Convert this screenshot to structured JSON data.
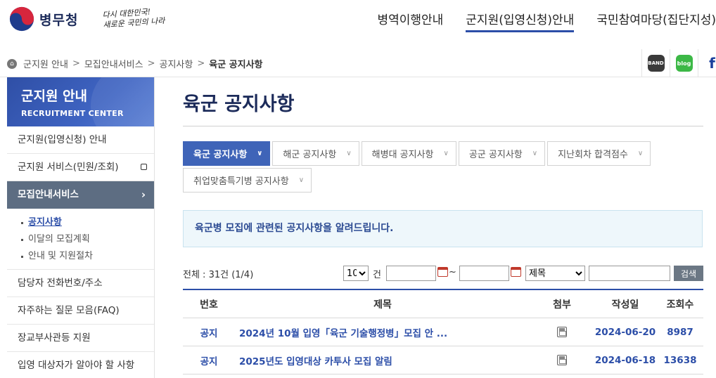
{
  "header": {
    "logo_text": "병무청",
    "slogan_line1": "다시 대한민국!",
    "slogan_line2": "새로운 국민의 나라",
    "gnb": [
      {
        "label": "병역이행안내",
        "active": false
      },
      {
        "label": "군지원(입영신청)안내",
        "active": true
      },
      {
        "label": "국민참여마당(집단지성)",
        "active": false
      }
    ]
  },
  "breadcrumb": [
    "군지원 안내",
    "모집안내서비스",
    "공지사항",
    "육군 공지사항"
  ],
  "social": [
    "BAND",
    "blog",
    "f"
  ],
  "sidebar": {
    "title": "군지원 안내",
    "subtitle": "RECRUITMENT CENTER",
    "items": [
      {
        "label": "군지원(입영신청) 안내"
      },
      {
        "label": "군지원 서비스(민원/조회)"
      },
      {
        "label": "모집안내서비스"
      },
      {
        "label": "담당자 전화번호/주소"
      },
      {
        "label": "자주하는 질문 모음(FAQ)"
      },
      {
        "label": "장교부사관등 지원"
      },
      {
        "label": "입영 대상자가 알아야 할 사항"
      }
    ],
    "subitems": [
      "공지사항",
      "이달의 모집계획",
      "안내 및 지원절차"
    ]
  },
  "main": {
    "page_title": "육군 공지사항",
    "tabs": [
      "육군 공지사항",
      "해군 공지사항",
      "해병대 공지사항",
      "공군 공지사항",
      "지난회차 합격점수",
      "취업맞춤특기병 공지사항"
    ],
    "notice": "육군병 모집에 관련된 공지사항을 알려드립니다.",
    "search": {
      "total": "전체 : 31건 (1/4)",
      "page_size": "10",
      "unit": "건",
      "tilde": "~",
      "field": "제목",
      "button": "검색"
    },
    "columns": [
      "번호",
      "제목",
      "첨부",
      "작성일",
      "조회수"
    ],
    "rows": [
      {
        "num": "공지",
        "title": "2024년 10월 입영「육군 기술행정병」모집 안 ...",
        "date": "2024-06-20",
        "views": "8987"
      },
      {
        "num": "공지",
        "title": "2025년도 입영대상 카투사 모집 알림",
        "date": "2024-06-18",
        "views": "13638"
      }
    ]
  },
  "colors": {
    "primary": "#2c4ea8",
    "tab_active": "#3f64b8",
    "sidebar_active": "#5d6d82",
    "notice_bg": "#eef7fb"
  },
  "icons": [
    "taegeuk-logo-icon",
    "home-icon",
    "band-icon",
    "blog-icon",
    "facebook-icon",
    "calendar-icon",
    "chevron-down-icon",
    "floppy-disk-icon",
    "external-window-icon",
    "chevron-right-icon"
  ]
}
